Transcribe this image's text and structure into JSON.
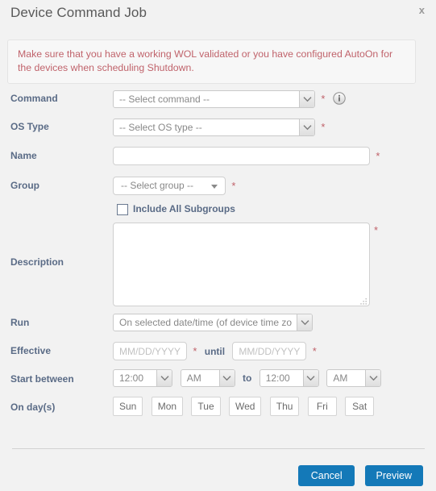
{
  "dialog": {
    "title": "Device Command Job",
    "close_label": "x"
  },
  "alert": {
    "text": "Make sure that you have a working WOL validated or you have configured AutoOn for the devices when scheduling Shutdown."
  },
  "fields": {
    "command": {
      "label": "Command",
      "value": "-- Select command --",
      "required": "*",
      "info_icon": "info-circle-icon"
    },
    "os_type": {
      "label": "OS Type",
      "value": "-- Select OS type --",
      "required": "*"
    },
    "name": {
      "label": "Name",
      "value": "",
      "placeholder": "",
      "required": "*"
    },
    "group": {
      "label": "Group",
      "value": "-- Select group --",
      "required": "*"
    },
    "include_subgroups": {
      "label": "Include All Subgroups",
      "checked": false
    },
    "description": {
      "label": "Description",
      "value": "",
      "placeholder": "",
      "required": "*"
    },
    "run": {
      "label": "Run",
      "value": "On selected date/time (of device time zo"
    },
    "effective": {
      "label": "Effective",
      "from_value": "",
      "from_placeholder": "MM/DD/YYYY",
      "from_required": "*",
      "until_label": "until",
      "to_value": "",
      "to_placeholder": "MM/DD/YYYY",
      "to_required": "*"
    },
    "start_between": {
      "label": "Start between",
      "from_time": "12:00",
      "from_meridiem": "AM",
      "to_word": "to",
      "to_time": "12:00",
      "to_meridiem": "AM"
    },
    "on_days": {
      "label": "On day(s)",
      "days": [
        "Sun",
        "Mon",
        "Tue",
        "Wed",
        "Thu",
        "Fri",
        "Sat"
      ]
    }
  },
  "footer": {
    "cancel_label": "Cancel",
    "preview_label": "Preview"
  },
  "colors": {
    "accent_blue": "#1479b8",
    "label_blue": "#5a6b86",
    "required_red": "#c0626a",
    "alert_text": "#c0636b",
    "page_bg": "#f2f2f2"
  }
}
